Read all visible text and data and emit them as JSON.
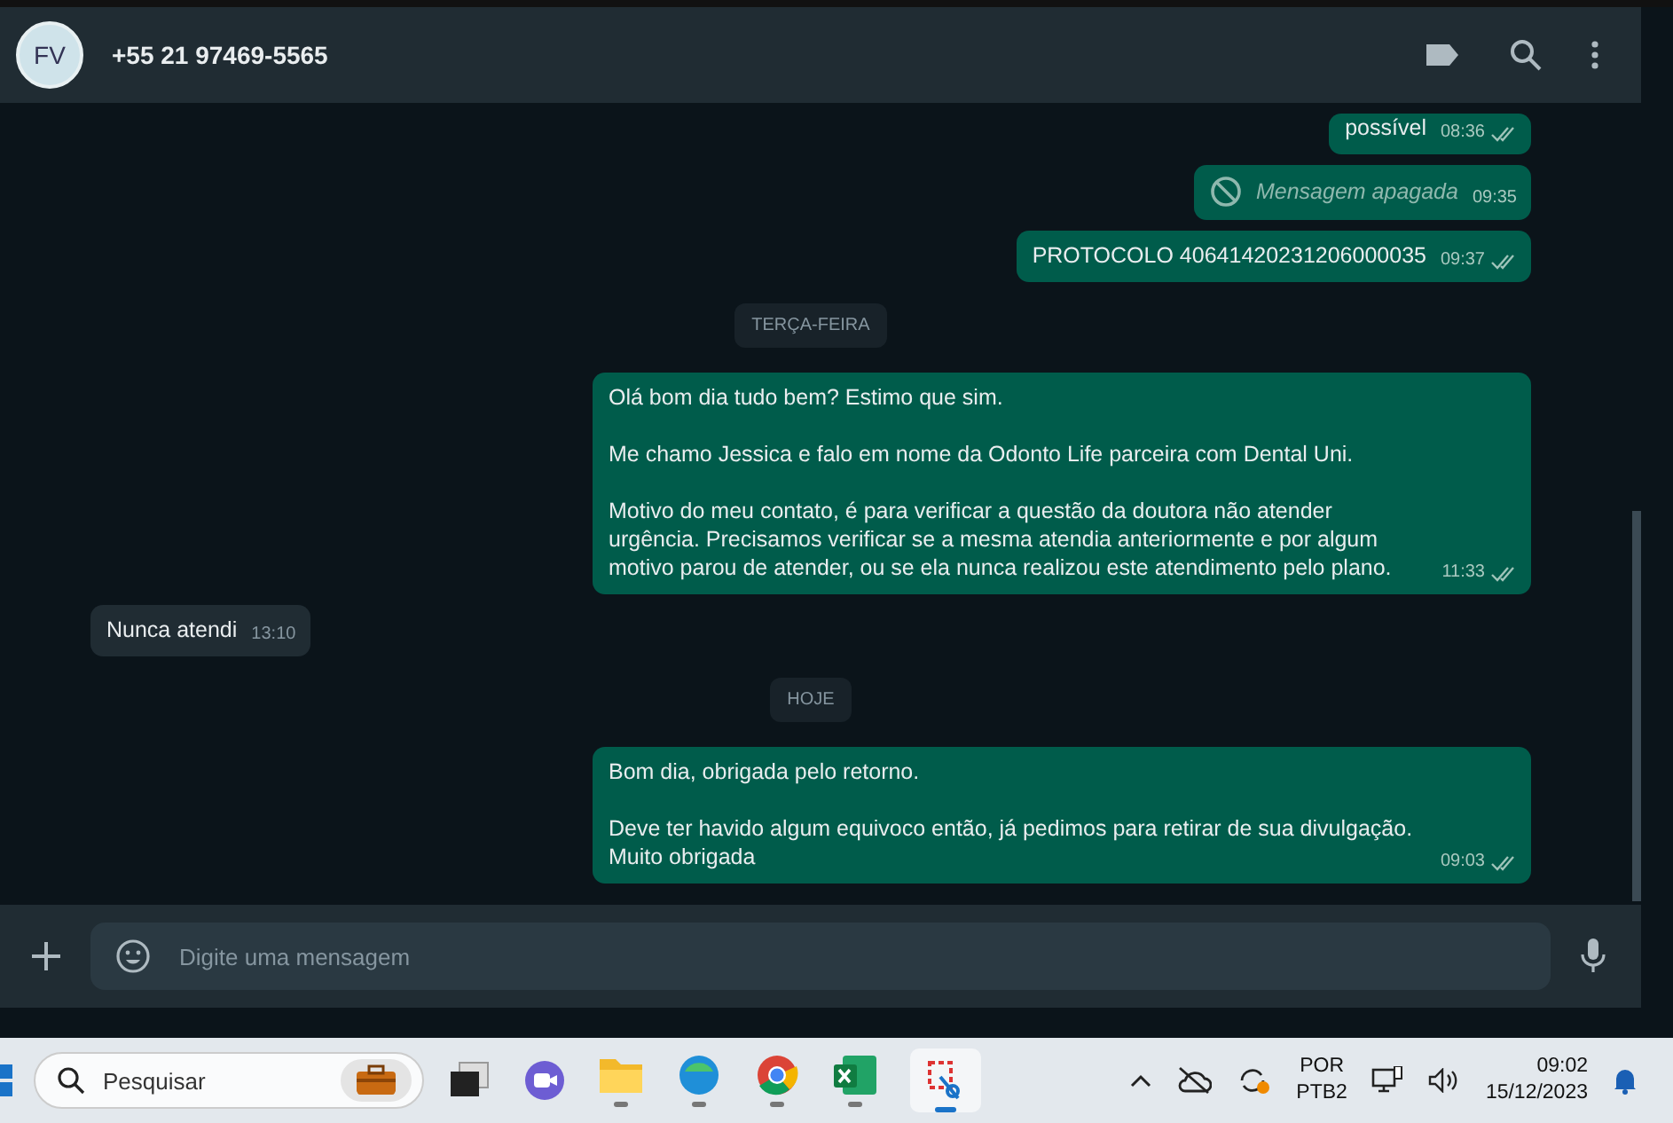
{
  "chat_header": {
    "contact_name": "+55 21 97469-5565",
    "avatar_initials": "FV"
  },
  "messages": [
    {
      "kind": "text",
      "outgoing": true,
      "text": "possível",
      "time": "08:36",
      "read": true
    },
    {
      "kind": "deleted",
      "outgoing": true,
      "text": "Mensagem apagada",
      "time": "09:35",
      "read": false
    },
    {
      "kind": "text",
      "outgoing": true,
      "text": "PROTOCOLO 40641420231206000035",
      "time": "09:37",
      "read": true
    },
    {
      "kind": "date",
      "text": "TERÇA-FEIRA"
    },
    {
      "kind": "text",
      "outgoing": true,
      "text": "Olá bom dia tudo bem? Estimo que sim.\n\nMe chamo Jessica e falo em nome da Odonto Life parceira com Dental Uni.\n\nMotivo do meu contato, é para verificar a questão da doutora não atender urgência. Precisamos verificar se a mesma atendia anteriormente e por algum motivo parou de atender, ou se ela nunca realizou este atendimento pelo plano.",
      "time": "11:33",
      "read": true
    },
    {
      "kind": "text",
      "outgoing": false,
      "text": "Nunca atendi",
      "time": "13:10",
      "read": false
    },
    {
      "kind": "date",
      "text": "HOJE"
    },
    {
      "kind": "text",
      "outgoing": true,
      "text": "Bom dia, obrigada pelo retorno.\n\nDeve ter havido algum equivoco então, já pedimos para retirar de sua divulgação. Muito obrigada",
      "time": "09:03",
      "read": true
    }
  ],
  "composer": {
    "placeholder": "Digite uma mensagem"
  },
  "taskbar": {
    "search_placeholder": "Pesquisar",
    "language": "POR",
    "layout": "PTB2",
    "time": "09:02",
    "date": "15/12/2023"
  }
}
